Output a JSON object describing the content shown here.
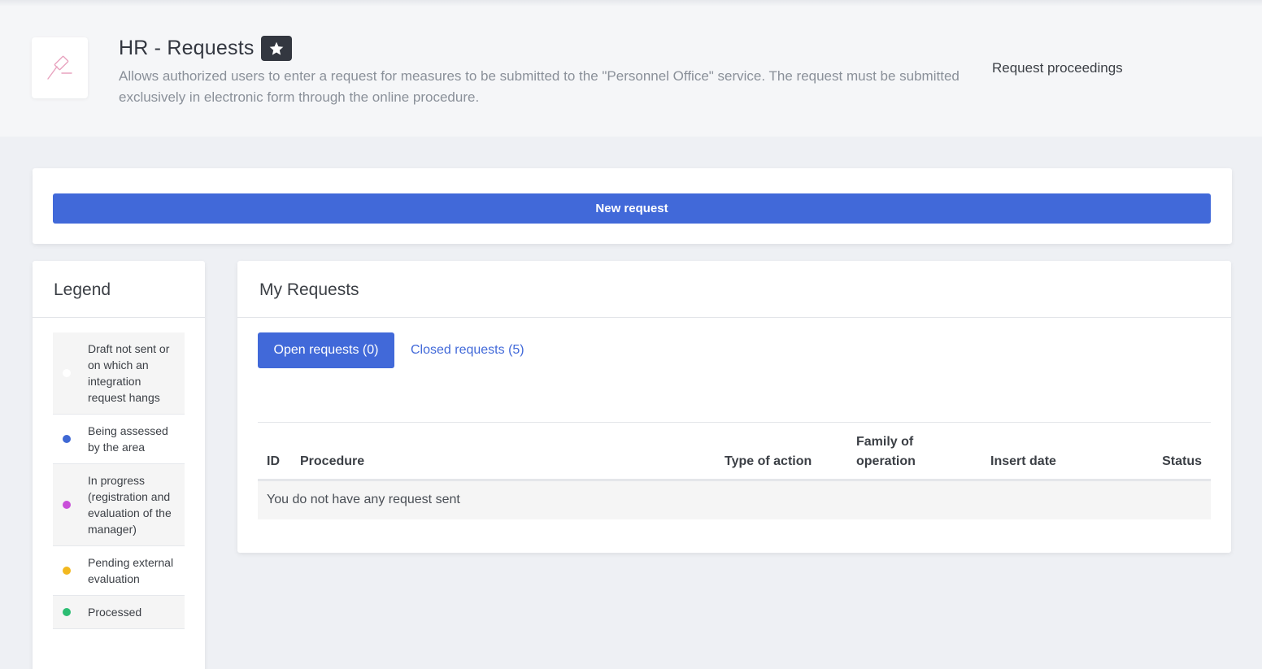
{
  "header": {
    "title": "HR - Requests",
    "description": "Allows authorized users to enter a request for measures to be submitted to the \"Personnel Office\" service. The request must be submitted exclusively in electronic form through the online procedure.",
    "link": "Request proceedings",
    "logo_icon": "gavel-icon",
    "favorite_icon": "star-icon"
  },
  "actions": {
    "new_request": "New request"
  },
  "legend": {
    "title": "Legend",
    "items": [
      {
        "label": "Draft not sent or on which an integration request hangs",
        "color": "#ffffff"
      },
      {
        "label": "Being assessed by the area",
        "color": "#3f68d4"
      },
      {
        "label": "In progress (registration and evaluation of the manager)",
        "color": "#c94fd9"
      },
      {
        "label": "Pending external evaluation",
        "color": "#f2b81f"
      },
      {
        "label": "Processed",
        "color": "#2cbd73"
      }
    ]
  },
  "requests": {
    "title": "My Requests",
    "tabs": {
      "open": "Open requests (0)",
      "closed": "Closed requests (5)"
    },
    "columns": {
      "id": "ID",
      "procedure": "Procedure",
      "type": "Type of action",
      "family": "Family of operation",
      "date": "Insert date",
      "status": "Status"
    },
    "empty": "You do not have any request sent"
  },
  "colors": {
    "accent": "#4169d9",
    "dark": "#333740"
  }
}
